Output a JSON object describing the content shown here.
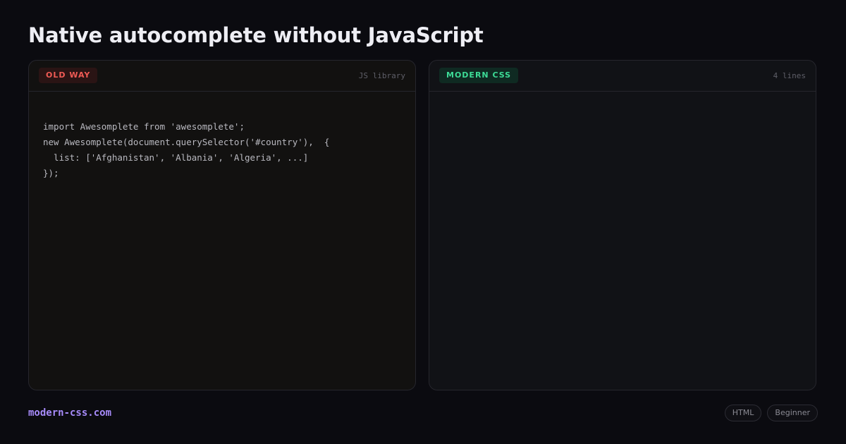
{
  "title": "Native autocomplete without JavaScript",
  "old_panel": {
    "badge": "OLD WAY",
    "meta": "JS library",
    "code_lines": [
      "import Awesomplete from 'awesomplete';",
      "new Awesomplete(document.querySelector('#country'),  {",
      "  list: ['Afghanistan', 'Albania', 'Algeria', ...]",
      "});"
    ]
  },
  "modern_panel": {
    "badge": "MODERN CSS",
    "meta": "4 lines"
  },
  "footer": {
    "brand": "modern-css.com",
    "tags": [
      "HTML",
      "Beginner"
    ]
  },
  "colors": {
    "background": "#0b0b10",
    "old_badge_text": "#f05b55",
    "modern_badge_text": "#3ddc97",
    "brand": "#a78bfa"
  }
}
